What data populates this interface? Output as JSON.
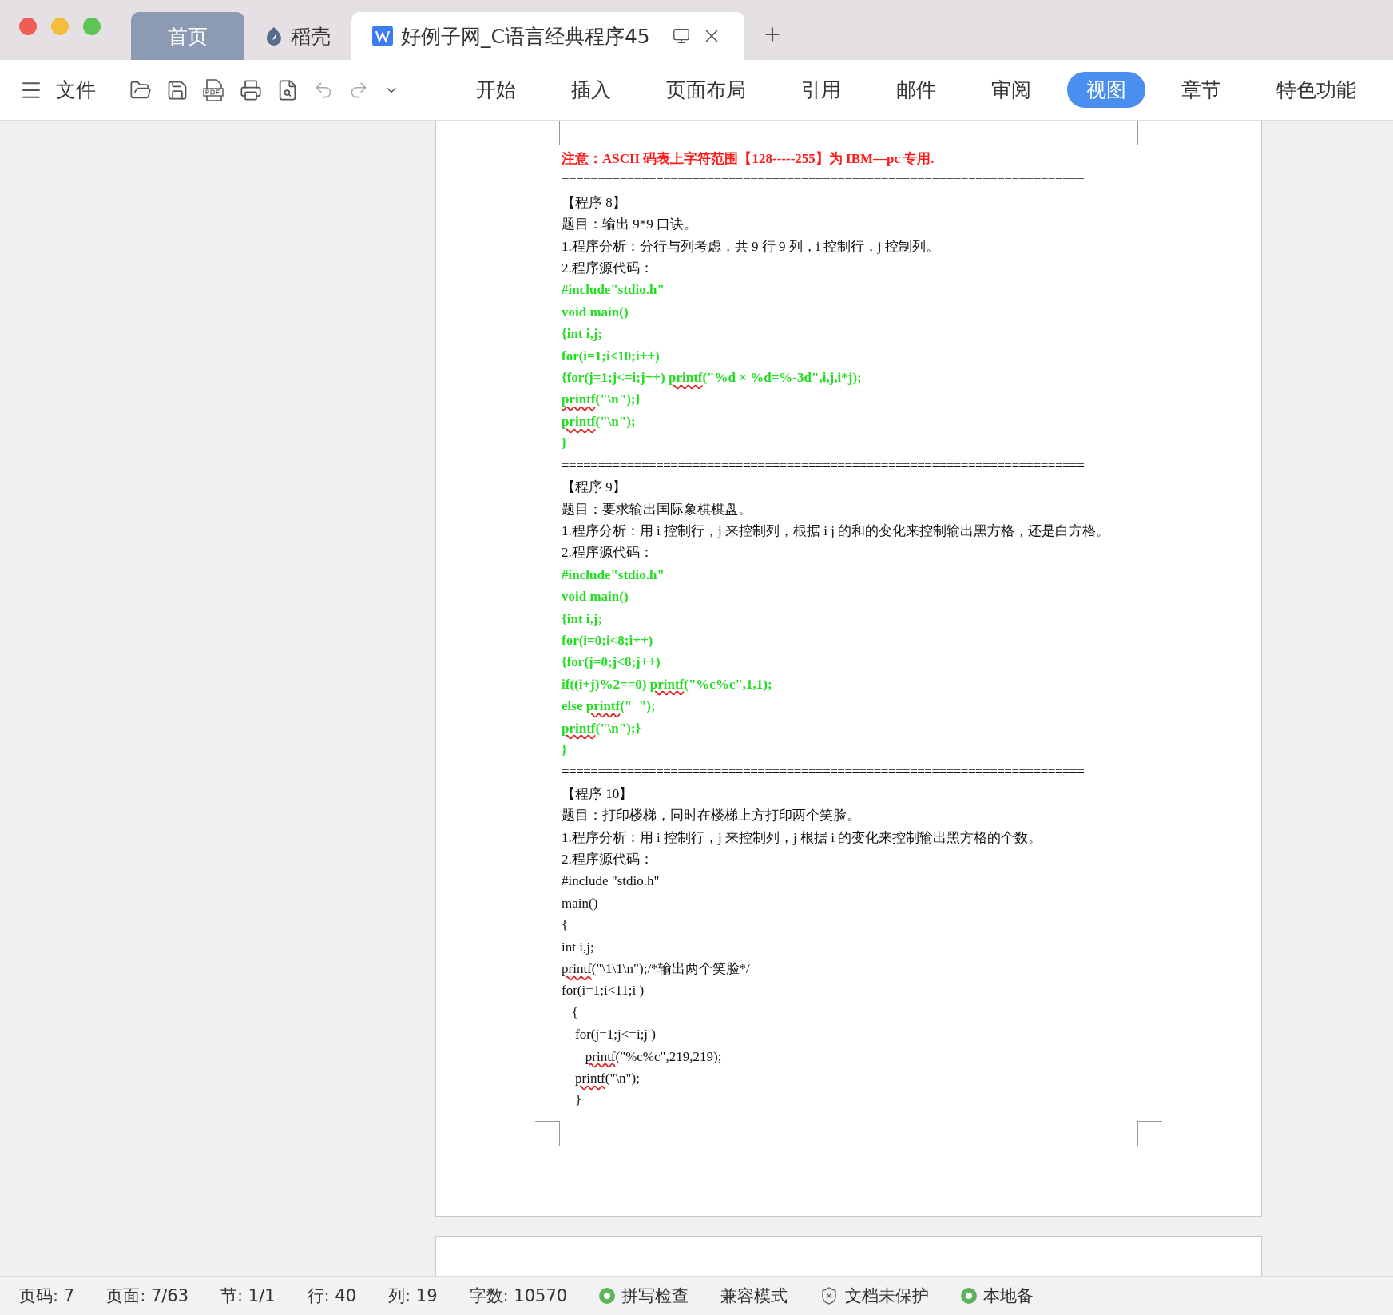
{
  "window_tabs": [
    {
      "kind": "home",
      "label": "首页",
      "selected": false
    },
    {
      "kind": "docer",
      "label": "稻壳",
      "selected": false
    },
    {
      "kind": "document",
      "label": "好例子网_C语言经典程序45",
      "selected": true
    }
  ],
  "toolbar": {
    "file_menu": "文件",
    "ribbon_tabs": [
      {
        "label": "开始",
        "selected": false
      },
      {
        "label": "插入",
        "selected": false
      },
      {
        "label": "页面布局",
        "selected": false
      },
      {
        "label": "引用",
        "selected": false
      },
      {
        "label": "邮件",
        "selected": false
      },
      {
        "label": "审阅",
        "selected": false
      },
      {
        "label": "视图",
        "selected": true
      },
      {
        "label": "章节",
        "selected": false
      },
      {
        "label": "特色功能",
        "selected": false
      }
    ]
  },
  "document": {
    "lines": [
      {
        "kind": "note",
        "text": "注意：ASCII 码表上字符范围【128-----255】为 IBM—pc 专用."
      },
      {
        "kind": "rule",
        "text": "========================================================================"
      },
      {
        "kind": "text",
        "text": "【程序 8】"
      },
      {
        "kind": "text",
        "text": "题目：输出 9*9 口诀。"
      },
      {
        "kind": "text",
        "text": "1.程序分析：分行与列考虑，共 9 行 9 列，i 控制行，j 控制列。"
      },
      {
        "kind": "text",
        "text": "2.程序源代码："
      },
      {
        "kind": "code",
        "text": "#include\"stdio.h\""
      },
      {
        "kind": "code",
        "text": "void main()"
      },
      {
        "kind": "code",
        "text": "{int i,j;"
      },
      {
        "kind": "code",
        "text": "for(i=1;i<10;i++)"
      },
      {
        "kind": "code",
        "parts": [
          {
            "text": "{for(j=1;j<=i;j++) ",
            "misspelled": false
          },
          {
            "text": "printf",
            "misspelled": true
          },
          {
            "text": "(\"%d × %d=%-3d\",i,j,i*j);",
            "misspelled": false
          }
        ]
      },
      {
        "kind": "code",
        "parts": [
          {
            "text": "printf",
            "misspelled": true
          },
          {
            "text": "(\"\\n\");}",
            "misspelled": false
          }
        ]
      },
      {
        "kind": "code",
        "parts": [
          {
            "text": "printf",
            "misspelled": true
          },
          {
            "text": "(\"\\n\");",
            "misspelled": false
          }
        ]
      },
      {
        "kind": "code",
        "text": "}"
      },
      {
        "kind": "rule",
        "text": "========================================================================"
      },
      {
        "kind": "text",
        "text": "【程序 9】"
      },
      {
        "kind": "text",
        "text": "题目：要求输出国际象棋棋盘。"
      },
      {
        "kind": "text",
        "text": "1.程序分析：用 i 控制行，j 来控制列，根据 i j 的和的变化来控制输出黑方格，还是白方格。"
      },
      {
        "kind": "text",
        "text": "2.程序源代码："
      },
      {
        "kind": "code",
        "text": "#include\"stdio.h\""
      },
      {
        "kind": "code",
        "text": "void main()"
      },
      {
        "kind": "code",
        "text": "{int i,j;"
      },
      {
        "kind": "code",
        "text": "for(i=0;i<8;i++)"
      },
      {
        "kind": "code",
        "text": "{for(j=0;j<8;j++)"
      },
      {
        "kind": "code",
        "parts": [
          {
            "text": "if((i+j)%2==0) ",
            "misspelled": false
          },
          {
            "text": "printf",
            "misspelled": true
          },
          {
            "text": "(\"%c%c\",1,1);",
            "misspelled": false
          }
        ]
      },
      {
        "kind": "code",
        "parts": [
          {
            "text": "else ",
            "misspelled": false
          },
          {
            "text": "printf",
            "misspelled": true
          },
          {
            "text": "(\"  \");",
            "misspelled": false
          }
        ]
      },
      {
        "kind": "code",
        "parts": [
          {
            "text": "printf",
            "misspelled": true
          },
          {
            "text": "(\"\\n\");}",
            "misspelled": false
          }
        ]
      },
      {
        "kind": "code",
        "text": "}"
      },
      {
        "kind": "rule",
        "text": "========================================================================"
      },
      {
        "kind": "text",
        "text": "【程序 10】"
      },
      {
        "kind": "text",
        "text": "题目：打印楼梯，同时在楼梯上方打印两个笑脸。"
      },
      {
        "kind": "text",
        "text": "1.程序分析：用 i 控制行，j 来控制列，j 根据 i 的变化来控制输出黑方格的个数。"
      },
      {
        "kind": "text",
        "text": "2.程序源代码："
      },
      {
        "kind": "plain",
        "text": "#include \"stdio.h\""
      },
      {
        "kind": "plain",
        "text": "main()"
      },
      {
        "kind": "plain",
        "text": "{"
      },
      {
        "kind": "plain",
        "text": "int i,j;"
      },
      {
        "kind": "plain",
        "parts": [
          {
            "text": "printf",
            "misspelled": true
          },
          {
            "text": "(\"\\1\\1\\n\");/*输出两个笑脸*/",
            "misspelled": false
          }
        ]
      },
      {
        "kind": "plain",
        "text": "for(i=1;i<11;i )"
      },
      {
        "kind": "plain",
        "text": "   {"
      },
      {
        "kind": "plain",
        "text": "    for(j=1;j<=i;j )"
      },
      {
        "kind": "plain",
        "parts": [
          {
            "text": "       printf",
            "misspelled": true
          },
          {
            "text": "(\"%c%c\",219,219);",
            "misspelled": false
          }
        ]
      },
      {
        "kind": "plain",
        "parts": [
          {
            "text": "    printf",
            "misspelled": true
          },
          {
            "text": "(\"\\n\");",
            "misspelled": false
          }
        ]
      },
      {
        "kind": "plain",
        "text": "    }"
      }
    ]
  },
  "status_bar": [
    {
      "kind": "text",
      "text": "页码: 7"
    },
    {
      "kind": "text",
      "text": "页面: 7/63"
    },
    {
      "kind": "text",
      "text": "节: 1/1"
    },
    {
      "kind": "text",
      "text": "行: 40"
    },
    {
      "kind": "text",
      "text": "列: 19"
    },
    {
      "kind": "text",
      "text": "字数: 10570"
    },
    {
      "kind": "ok",
      "text": "拼写检查"
    },
    {
      "kind": "text",
      "text": "兼容模式"
    },
    {
      "kind": "shield",
      "text": "文档未保护"
    },
    {
      "kind": "ok",
      "text": "本地备"
    }
  ]
}
